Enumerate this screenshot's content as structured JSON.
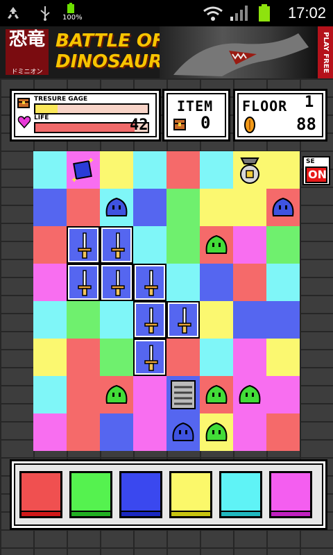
{
  "status_bar": {
    "battery_percent": "100%",
    "time": "17:02"
  },
  "ad": {
    "kanji": "恐竜",
    "kanji_sub": "ドミニオン",
    "title_line1": "BATTLE OF",
    "title_line2": "DINOSAURS",
    "side_label": "PLAY FREE"
  },
  "hud": {
    "treasure_gage_label": "TRESURE GAGE",
    "treasure_gage_level": 0.2,
    "life_label": "LIFE",
    "life_level": 0.88,
    "life_value": "42",
    "item_label": "ITEM",
    "item_count": "0",
    "floor_label": "FLOOR",
    "floor_top": "1",
    "floor_value": "88"
  },
  "se_toggle": {
    "label": "SE",
    "state": "ON"
  },
  "colors": {
    "cyan": "#7ff6f8",
    "blue": "#5566f0",
    "yellow": "#fbf870",
    "red": "#f56a6a",
    "green": "#6ff06e",
    "magenta": "#f86ef0",
    "slime_green": "#42dc38",
    "slime_blue": "#3f53e0"
  },
  "grid": {
    "rows": [
      [
        "cyan",
        "magenta",
        "yellow",
        "cyan",
        "red",
        "cyan",
        "yellow",
        "yellow"
      ],
      [
        "blue",
        "red",
        "cyan",
        "blue",
        "green",
        "yellow",
        "yellow",
        "red"
      ],
      [
        "red",
        "blue",
        "blue",
        "cyan",
        "green",
        "red",
        "magenta",
        "green"
      ],
      [
        "magenta",
        "blue",
        "blue",
        "blue",
        "cyan",
        "blue",
        "red",
        "cyan"
      ],
      [
        "cyan",
        "green",
        "cyan",
        "blue",
        "blue",
        "yellow",
        "blue",
        "blue"
      ],
      [
        "yellow",
        "red",
        "green",
        "blue",
        "red",
        "cyan",
        "magenta",
        "yellow"
      ],
      [
        "cyan",
        "red",
        "red",
        "magenta",
        "blue",
        "red",
        "magenta",
        "magenta"
      ],
      [
        "magenta",
        "red",
        "blue",
        "magenta",
        "blue",
        "yellow",
        "magenta",
        "red"
      ]
    ],
    "objects": [
      {
        "r": 0,
        "c": 1,
        "type": "gem"
      },
      {
        "r": 0,
        "c": 6,
        "type": "treasure-bag"
      },
      {
        "r": 1,
        "c": 2,
        "type": "slime-blue"
      },
      {
        "r": 1,
        "c": 7,
        "type": "slime-blue"
      },
      {
        "r": 2,
        "c": 1,
        "type": "sword"
      },
      {
        "r": 2,
        "c": 2,
        "type": "sword"
      },
      {
        "r": 2,
        "c": 5,
        "type": "slime-green"
      },
      {
        "r": 3,
        "c": 1,
        "type": "sword"
      },
      {
        "r": 3,
        "c": 2,
        "type": "sword"
      },
      {
        "r": 3,
        "c": 3,
        "type": "sword"
      },
      {
        "r": 4,
        "c": 3,
        "type": "sword"
      },
      {
        "r": 4,
        "c": 4,
        "type": "sword"
      },
      {
        "r": 5,
        "c": 3,
        "type": "sword"
      },
      {
        "r": 6,
        "c": 2,
        "type": "slime-green"
      },
      {
        "r": 6,
        "c": 4,
        "type": "stairs"
      },
      {
        "r": 6,
        "c": 5,
        "type": "slime-green"
      },
      {
        "r": 6,
        "c": 6,
        "type": "slime-green"
      },
      {
        "r": 7,
        "c": 4,
        "type": "slime-blue"
      },
      {
        "r": 7,
        "c": 5,
        "type": "slime-green"
      }
    ]
  },
  "palette": [
    "red",
    "green",
    "blue",
    "yellow",
    "cyan",
    "magenta"
  ],
  "palette_stripes": [
    "#d01818",
    "#22b022",
    "#1a28c0",
    "#c8c410",
    "#20b8c0",
    "#c020c0"
  ]
}
